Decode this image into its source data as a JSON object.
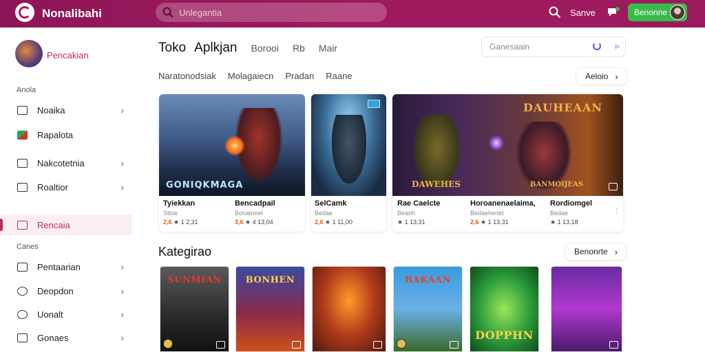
{
  "topbar": {
    "brand": "Nonalibahi",
    "search_placeholder": "Unlegantia",
    "signin_label": "Sanve",
    "cta_label": "Benonne"
  },
  "sidebar": {
    "profile_name": "Pencakian",
    "section1": "Anola",
    "items": [
      {
        "label": "Noaika",
        "icon": "crown-icon"
      },
      {
        "label": "Rapalota",
        "icon": "flag-icon"
      },
      {
        "label": "Nakcotetnia",
        "icon": "terminal-icon"
      },
      {
        "label": "Roaltior",
        "icon": "box-icon"
      },
      {
        "label": "Rencaia",
        "icon": "calendar-icon"
      }
    ],
    "section2": "Canes",
    "items2": [
      {
        "label": "Pentaarian",
        "icon": "box-icon"
      },
      {
        "label": "Deopdon",
        "icon": "compass-icon"
      },
      {
        "label": "Uonalt",
        "icon": "clock-icon"
      },
      {
        "label": "Gonaes",
        "icon": "folder-icon"
      }
    ]
  },
  "main": {
    "tabs": [
      "Toko",
      "Aplkjan",
      "Borooi",
      "Rb",
      "Mair"
    ],
    "search_placeholder": "Ganesaain",
    "subtabs": [
      "Naratonodsiak",
      "Molagaiecn",
      "Pradan",
      "Raane"
    ],
    "more_button": "Aeloio",
    "cards": [
      {
        "title": "Tyiekkan",
        "meta": "Sttoe",
        "price": "2,6",
        "price_rest": "★ 1 2,31"
      },
      {
        "title": "Bencadpail",
        "meta": "Bonatnoel",
        "price": "3,6",
        "price_rest": "★ 4 13,04"
      },
      {
        "title": "SelCamk",
        "meta": "Bedae",
        "price": "2,6",
        "price_rest": "★ 1 11,00"
      },
      {
        "title": "Rae Caelcte",
        "meta": "Beanh",
        "price": "",
        "price_rest": "★ 1 13,31"
      },
      {
        "title": "Horoanenaelaima,",
        "meta": "Bedaehenet",
        "price": "2,6",
        "price_rest": "★ 1 13,31"
      },
      {
        "title": "Rordiomgel",
        "meta": "Bedae",
        "price": "",
        "price_rest": "★ 1 13,18"
      }
    ],
    "card_art_text": [
      "GONIQKMAGA",
      "DAUHEAAN",
      "DAWEHES",
      "BANMOIJEAS"
    ],
    "section_title": "Kategirao",
    "section_button": "Benonrte",
    "tiles": [
      "SUNMIAN",
      "BONHEN",
      "",
      "BAKAAN",
      "DOPPHN",
      ""
    ]
  }
}
